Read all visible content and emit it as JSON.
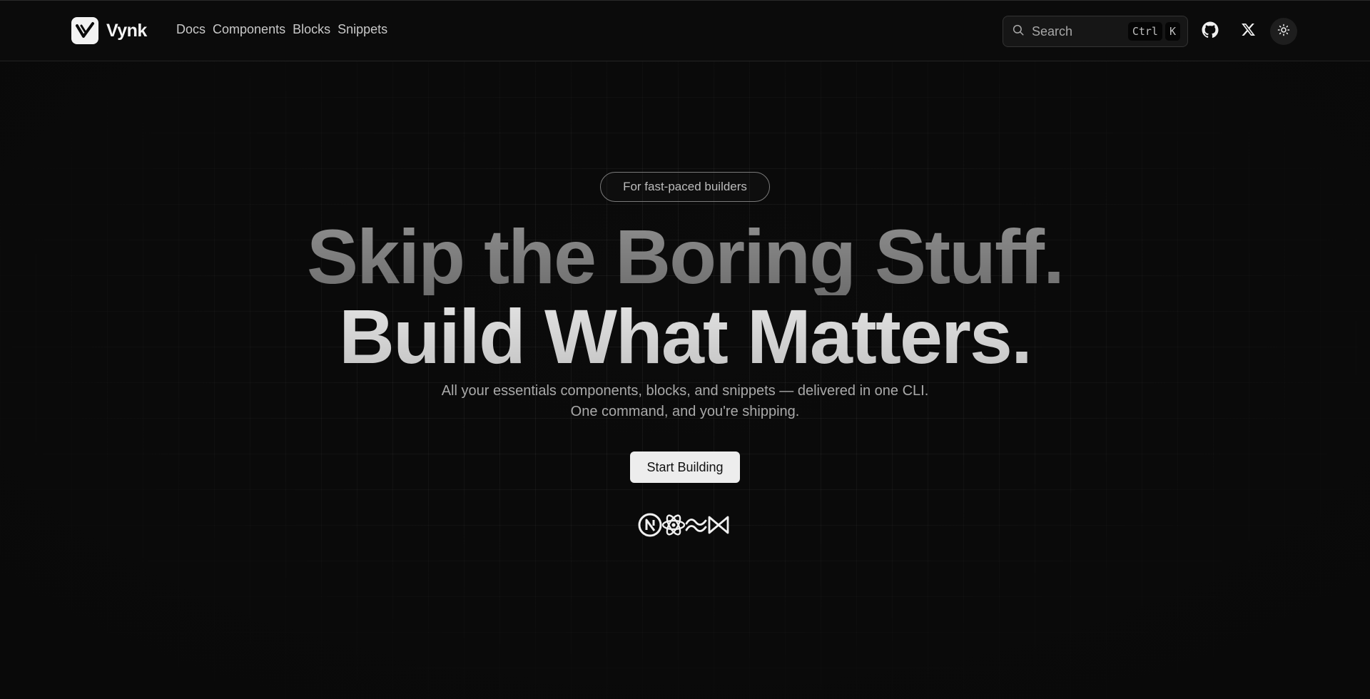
{
  "header": {
    "brand": "Vynk",
    "nav": [
      "Docs",
      "Components",
      "Blocks",
      "Snippets"
    ],
    "search": {
      "placeholder": "Search",
      "shortcut": [
        "Ctrl",
        "K"
      ]
    },
    "icons": [
      "github-icon",
      "x-icon",
      "sun-icon"
    ]
  },
  "hero": {
    "badge": "For fast-paced builders",
    "headline_line1": "Skip the Boring Stuff.",
    "headline_line2": "Build What Matters.",
    "subtitle_line1": "All your essentials components, blocks, and snippets — delivered in one CLI.",
    "subtitle_line2": "One command, and you're shipping.",
    "cta": "Start Building",
    "tech_icons": [
      "nextjs-icon",
      "react-icon",
      "tailwind-icon",
      "framer-motion-icon"
    ]
  },
  "colors": {
    "background": "#0b0b0b",
    "text_primary": "#f5f5f5",
    "text_muted": "#a9a9a9",
    "button_bg": "#ededed"
  }
}
